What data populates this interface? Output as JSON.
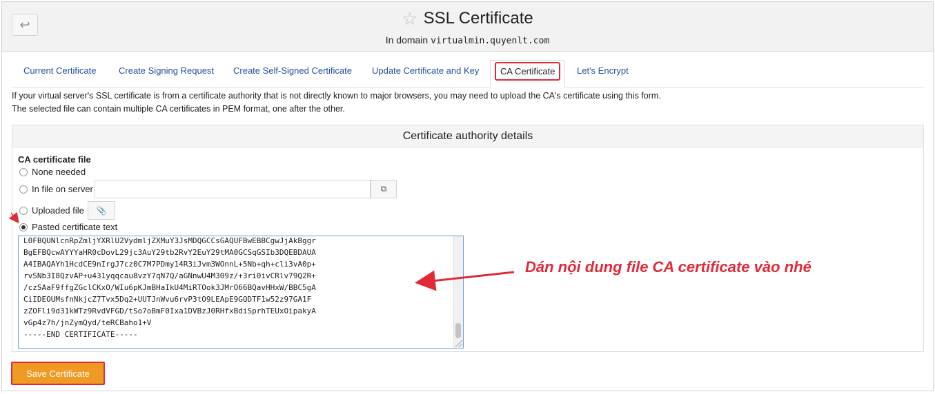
{
  "header": {
    "back_icon": "back-arrow-icon",
    "star_icon": "star-icon",
    "title": "SSL Certificate",
    "subtitle_prefix": "In domain",
    "domain": "virtualmin.quyenlt.com"
  },
  "tabs": [
    {
      "label": "Current Certificate"
    },
    {
      "label": "Create Signing Request"
    },
    {
      "label": "Create Self-Signed Certificate"
    },
    {
      "label": "Update Certificate and Key"
    },
    {
      "label": "CA Certificate",
      "active": true
    },
    {
      "label": "Let's Encrypt"
    }
  ],
  "description": {
    "line1": "If your virtual server's SSL certificate is from a certificate authority that is not directly known to major browsers, you may need to upload the CA's certificate using this form.",
    "line2": "The selected file can contain multiple CA certificates in PEM format, one after the other."
  },
  "panel": {
    "heading": "Certificate authority details",
    "field_label": "CA certificate file",
    "options": {
      "none": "None needed",
      "server_file": "In file on server",
      "uploaded": "Uploaded file",
      "pasted": "Pasted certificate text"
    },
    "selected_option": "pasted",
    "server_file_value": "",
    "file_chooser_icon": "file-chooser-icon",
    "attach_icon": "paperclip-icon",
    "certificate_lines": [
      "L0FBQUNlcnRpZmljYXRlU2VydmljZXMuY3JsMDQGCCsGAQUFBwEBBCgwJjAkBggr",
      "BgEFBQcwAYYYaHR0cDovL29jc3AuY29tb2RvY2EuY29tMA0GCSqGSIb3DQEBDAUA",
      "A4IBAQAYh1HcdCE9nIrgJ7cz0C7M7PDmy14R3iJvm3WOnnL+5Nb+qh+cli3vA0p+",
      "rvSNb3I8QzvAP+u431yqqcau8vzY7qN7Q/aGNnwU4M309z/+3ri0ivCRlv79Q2R+",
      "/czSAaF9ffgZGclCKxO/WIu6pKJmBHaIkU4MiRTOok3JMrO66BQavHHxW/BBC5gA",
      "CiIDEOUMsfnNkjcZ7Tvx5Dq2+UUTJnWvu6rvP3tO9LEApE9GQDTF1w52z97GA1F",
      "zZOFli9d31kWTz9RvdVFGD/tSo7oBmF0Ixa1DVBzJ0RHfxBdiSprhTEUxOipakyA",
      "vGp4z7h/jnZymQyd/teRCBaho1+V",
      "-----END CERTIFICATE-----"
    ]
  },
  "annotation": "Dán nội dung file CA certificate vào nhé",
  "save_button": "Save Certificate",
  "colors": {
    "link": "#1f4e9b",
    "highlight": "#e02a3a",
    "save_bg": "#ef9a22"
  }
}
